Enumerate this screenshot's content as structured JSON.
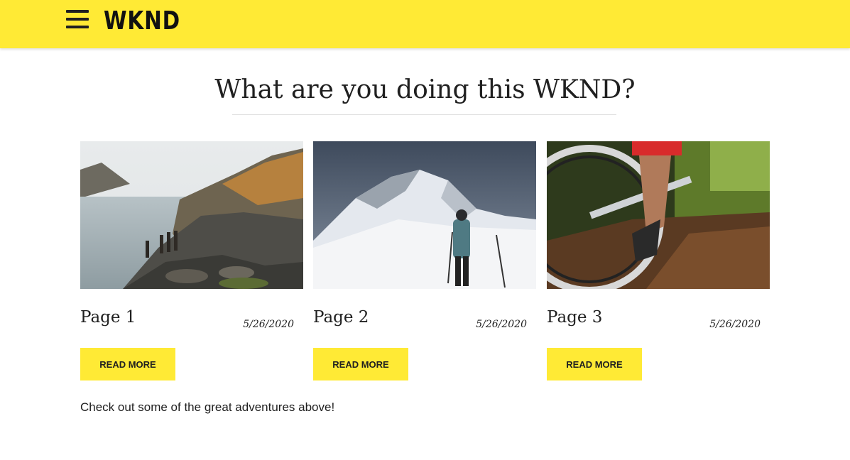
{
  "header": {
    "logo_text": "WKND",
    "menu_icon": "hamburger-menu-icon",
    "background": "#ffea35"
  },
  "main": {
    "title": "What are you doing this WKND?",
    "cards": [
      {
        "title": "Page 1",
        "date": "5/26/2020",
        "button_label": "READ MORE",
        "image": "mountain-lake-hikers-photo"
      },
      {
        "title": "Page 2",
        "date": "5/26/2020",
        "button_label": "READ MORE",
        "image": "snowy-mountain-climber-photo"
      },
      {
        "title": "Page 3",
        "date": "5/26/2020",
        "button_label": "READ MORE",
        "image": "mountain-bike-trail-photo"
      }
    ],
    "footer_text": "Check out some of the great adventures above!"
  },
  "colors": {
    "accent": "#ffea35",
    "text": "#202020"
  }
}
